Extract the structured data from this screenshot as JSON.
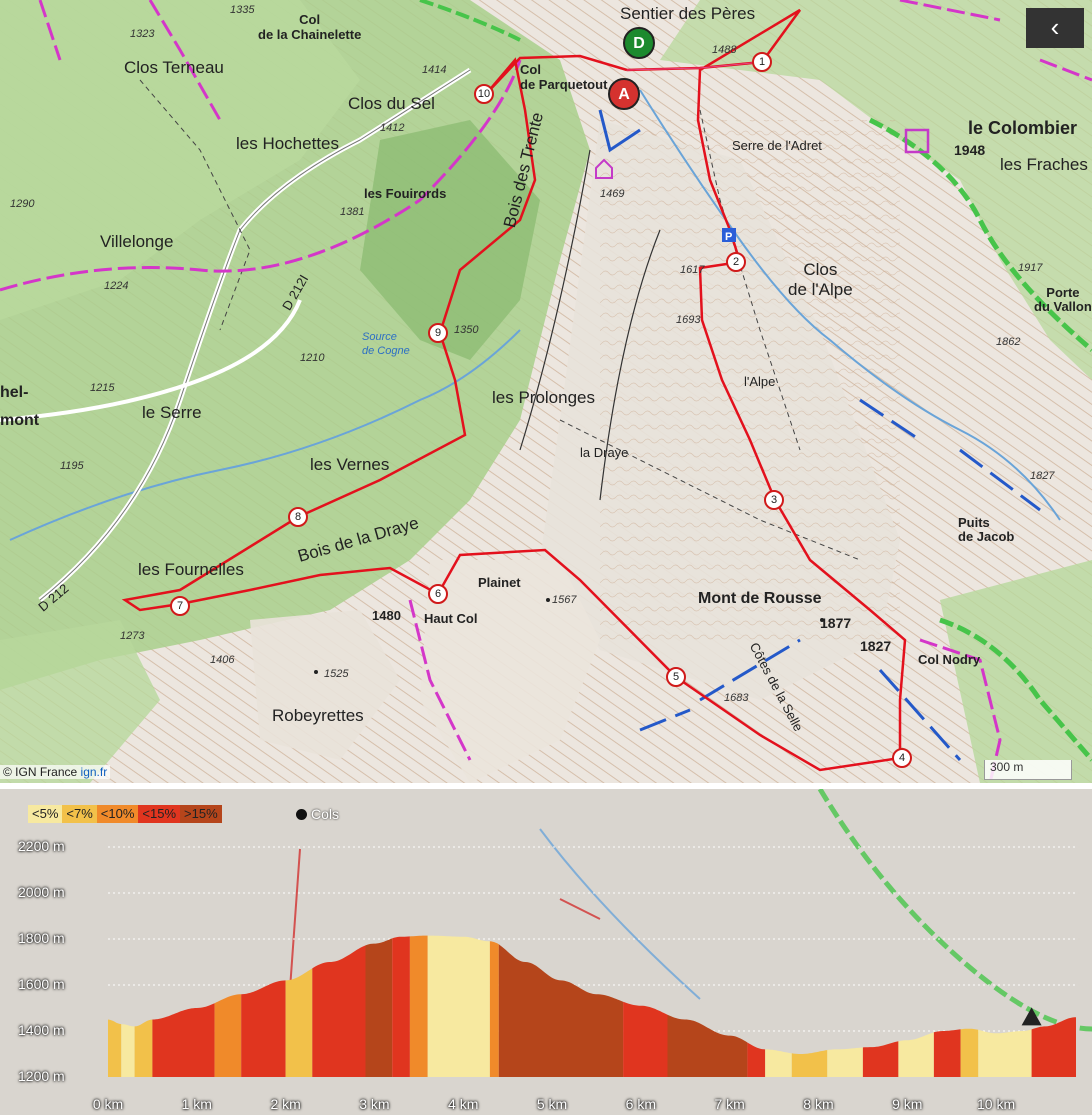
{
  "map": {
    "attribution_prefix": "© IGN France",
    "attribution_link": "ign.fr",
    "scale_label": "300 m",
    "back_glyph": "‹",
    "start_marker": "D",
    "end_marker": "A",
    "waypoints": [
      "1",
      "2",
      "3",
      "4",
      "5",
      "6",
      "7",
      "8",
      "9",
      "10"
    ],
    "place_names": {
      "clos_terneau": "Clos Terneau",
      "clos_du_sel": "Clos du Sel",
      "les_hochettes": "les Hochettes",
      "villelonge": "Villelonge",
      "le_serre": "le Serre",
      "les_vernes": "les Vernes",
      "les_fournelles": "les Fournelles",
      "bois_de_la_draye": "Bois de la Draye",
      "les_prolonges": "les Prolonges",
      "bois_des_trente": "Bois des Trente",
      "la_draye": "la Draye",
      "plainet": "Plainet",
      "haut_col": "Haut Col",
      "robeyrettes": "Robeyrettes",
      "mont_de_rousse": "Mont de Rousse",
      "col_nodry": "Col Nodry",
      "puits_de_jacob": "Puits\nde Jacob",
      "le_colombier": "le Colombier",
      "les_fraches": "les Fraches",
      "porte_du_vallon": "Porte\ndu Vallon",
      "clos_de_l_alpe": "Clos\nde l'Alpe",
      "l_alpe": "l'Alpe",
      "serre_de_l_adret": "Serre de l'Adret",
      "sentier_des_peres": "Sentier des Pères",
      "col_de_parquetout": "Col\nde Parquetout",
      "col_de_la_chainelette": "Col\nde la Chainelette",
      "les_fouirords": "les Fouirords",
      "source_de_cogne": "Source\nde Cogne",
      "cotes_de_la_selle": "Côtes de la Selle",
      "d212": "D 212",
      "d212i": "D 212I",
      "mont": "mont",
      "hel": "hel-"
    },
    "elevations": {
      "e1335": "1335",
      "e1323": "1323",
      "e1414": "1414",
      "e1412": "1412",
      "e1290": "1290",
      "e1224": "1224",
      "e1215": "1215",
      "e1195": "1195",
      "e1210": "1210",
      "e1350": "1350",
      "e1469": "1469",
      "e1488": "1488",
      "e1948": "1948",
      "e1917": "1917",
      "e1862": "1862",
      "e1827a": "1827",
      "e1827b": "1827",
      "e1877": "1877",
      "e1567": "1567",
      "e1480": "1480",
      "e1525": "1525",
      "e1406": "1406",
      "e1273": "1273",
      "e1683": "1683",
      "e1693": "1693",
      "e1617": "1617",
      "e1381": "1381"
    }
  },
  "profile": {
    "legend": [
      {
        "label": "<5%",
        "color": "#f7e9a0"
      },
      {
        "label": "<7%",
        "color": "#f2c14a"
      },
      {
        "label": "<10%",
        "color": "#f08a2a"
      },
      {
        "label": "<15%",
        "color": "#e0351f"
      },
      {
        "label": ">15%",
        "color": "#b5451b"
      }
    ],
    "cols_label": "Cols"
  },
  "chart_data": {
    "type": "area",
    "xlabel": "",
    "ylabel": "",
    "x_unit": "km",
    "y_unit": "m",
    "xlim": [
      0,
      10.9
    ],
    "ylim": [
      1200,
      2200
    ],
    "x_ticks": [
      "0 km",
      "1 km",
      "2 km",
      "3 km",
      "4 km",
      "5 km",
      "6 km",
      "7 km",
      "8 km",
      "9 km",
      "10 km"
    ],
    "y_ticks": [
      "1200 m",
      "1400 m",
      "1600 m",
      "1800 m",
      "2000 m",
      "2200 m"
    ],
    "grid": true,
    "legend_position": "top-left",
    "x": [
      0,
      0.15,
      0.3,
      0.5,
      1.0,
      1.5,
      2.0,
      2.5,
      3.0,
      3.3,
      3.6,
      4.0,
      4.3,
      4.7,
      5.1,
      5.5,
      6.0,
      6.5,
      7.0,
      7.4,
      7.8,
      8.2,
      8.6,
      9.0,
      9.4,
      9.7,
      10.0,
      10.3,
      10.55,
      10.9
    ],
    "y": [
      1450,
      1430,
      1420,
      1450,
      1500,
      1560,
      1620,
      1700,
      1780,
      1810,
      1815,
      1810,
      1790,
      1700,
      1620,
      1560,
      1510,
      1450,
      1380,
      1320,
      1300,
      1320,
      1330,
      1360,
      1400,
      1410,
      1390,
      1400,
      1420,
      1460
    ],
    "gradient_segments": [
      {
        "from": 0.0,
        "to": 0.15,
        "class": "<7%"
      },
      {
        "from": 0.15,
        "to": 0.3,
        "class": "<5%"
      },
      {
        "from": 0.3,
        "to": 0.5,
        "class": "<7%"
      },
      {
        "from": 0.5,
        "to": 1.2,
        "class": "<15%"
      },
      {
        "from": 1.2,
        "to": 1.5,
        "class": "<10%"
      },
      {
        "from": 1.5,
        "to": 2.0,
        "class": "<15%"
      },
      {
        "from": 2.0,
        "to": 2.3,
        "class": "<7%"
      },
      {
        "from": 2.3,
        "to": 2.9,
        "class": "<15%"
      },
      {
        "from": 2.9,
        "to": 3.2,
        "class": ">15%"
      },
      {
        "from": 3.2,
        "to": 3.4,
        "class": "<15%"
      },
      {
        "from": 3.4,
        "to": 3.6,
        "class": "<10%"
      },
      {
        "from": 3.6,
        "to": 4.3,
        "class": "<5%"
      },
      {
        "from": 4.3,
        "to": 4.4,
        "class": "<10%"
      },
      {
        "from": 4.4,
        "to": 5.8,
        "class": ">15%"
      },
      {
        "from": 5.8,
        "to": 6.3,
        "class": "<15%"
      },
      {
        "from": 6.3,
        "to": 7.2,
        "class": ">15%"
      },
      {
        "from": 7.2,
        "to": 7.4,
        "class": "<15%"
      },
      {
        "from": 7.4,
        "to": 7.7,
        "class": "<5%"
      },
      {
        "from": 7.7,
        "to": 8.1,
        "class": "<7%"
      },
      {
        "from": 8.1,
        "to": 8.5,
        "class": "<5%"
      },
      {
        "from": 8.5,
        "to": 8.9,
        "class": "<15%"
      },
      {
        "from": 8.9,
        "to": 9.3,
        "class": "<5%"
      },
      {
        "from": 9.3,
        "to": 9.6,
        "class": "<15%"
      },
      {
        "from": 9.6,
        "to": 9.8,
        "class": "<7%"
      },
      {
        "from": 9.8,
        "to": 10.4,
        "class": "<5%"
      },
      {
        "from": 10.4,
        "to": 10.9,
        "class": "<15%"
      }
    ]
  }
}
